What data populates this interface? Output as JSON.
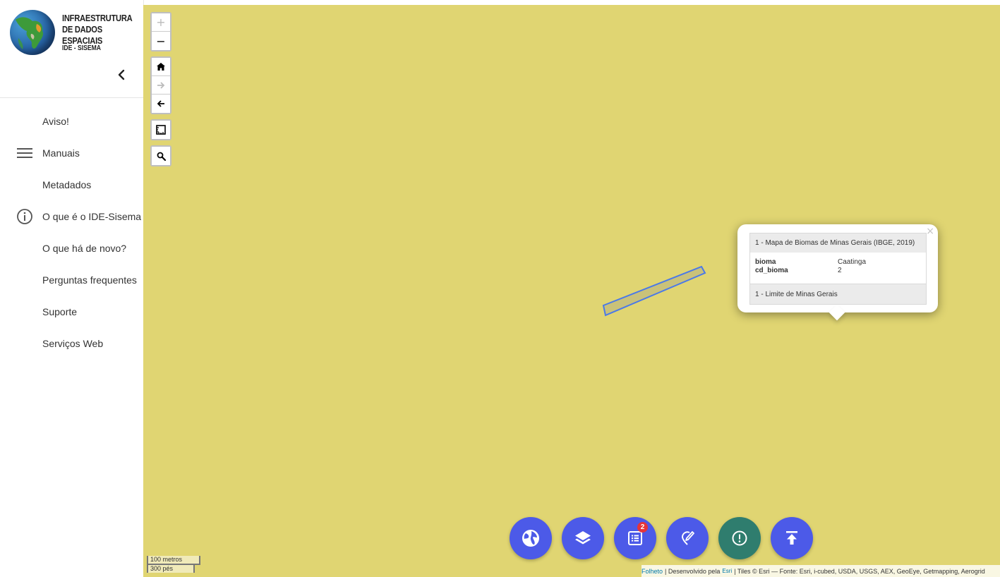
{
  "app": {
    "logo_title_line1": "INFRAESTRUTURA",
    "logo_title_line2": "DE DADOS ESPACIAIS",
    "logo_subtitle": "IDE - SISEMA"
  },
  "sidebar": {
    "collapse_icon": "chevron-left-icon",
    "items": [
      {
        "label": "Aviso!",
        "icon": null
      },
      {
        "label": "Manuais",
        "icon": "hamburger-menu-icon"
      },
      {
        "label": "Metadados",
        "icon": null
      },
      {
        "label": "O que é o IDE-Sisema",
        "icon": "info-circle-icon"
      },
      {
        "label": "O que há de novo?",
        "icon": null
      },
      {
        "label": "Perguntas frequentes",
        "icon": null
      },
      {
        "label": "Suporte",
        "icon": null
      },
      {
        "label": "Serviços Web",
        "icon": null
      }
    ]
  },
  "map": {
    "background_color": "#e0d572",
    "controls": {
      "zoom_in": "+",
      "zoom_out": "−",
      "home_icon": "home-icon",
      "forward_icon": "arrow-right-icon",
      "back_icon": "arrow-left-icon",
      "measure_icon": "measure-icon",
      "search_icon": "search-icon"
    },
    "popup": {
      "close": "×",
      "header": "1 - Mapa de Biomas de Minas Gerais (IBGE, 2019)",
      "rows": [
        {
          "key": "bioma",
          "value": "Caatinga"
        },
        {
          "key": "cd_bioma",
          "value": "2"
        }
      ],
      "footer": "1 - Limite de Minas Gerais"
    },
    "fab_buttons": [
      {
        "name": "basemap-button",
        "icon": "globe-icon",
        "color": "#4c5ae8"
      },
      {
        "name": "layers-button",
        "icon": "layers-icon",
        "color": "#4c5ae8"
      },
      {
        "name": "legend-button",
        "icon": "list-icon",
        "color": "#4c5ae8",
        "badge": "2"
      },
      {
        "name": "draw-button",
        "icon": "pen-icon",
        "color": "#4c5ae8"
      },
      {
        "name": "alert-button",
        "icon": "exclamation-circle-icon",
        "color": "#2f7d6e"
      },
      {
        "name": "upload-button",
        "icon": "upload-icon",
        "color": "#4c5ae8"
      }
    ],
    "scale": {
      "metric": "100 metros",
      "imperial": "300 pés"
    },
    "attribution": {
      "leaflet": "Folheto",
      "developed_by": "| Desenvolvido pela",
      "esri": "Esri",
      "tiles": "| Tiles © Esri — Fonte: Esri, i-cubed, USDA, USGS, AEX, GeoEye, Getmapping, Aerogrid"
    }
  }
}
